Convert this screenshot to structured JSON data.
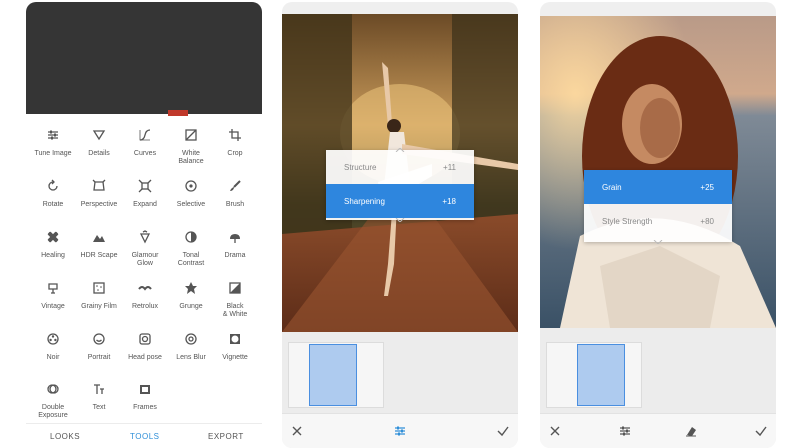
{
  "phone1": {
    "tools": [
      {
        "label": "Tune Image",
        "icon": "tune-icon"
      },
      {
        "label": "Details",
        "icon": "details-icon"
      },
      {
        "label": "Curves",
        "icon": "curves-icon"
      },
      {
        "label": "White\nBalance",
        "icon": "white-balance-icon"
      },
      {
        "label": "Crop",
        "icon": "crop-icon"
      },
      {
        "label": "Rotate",
        "icon": "rotate-icon"
      },
      {
        "label": "Perspective",
        "icon": "perspective-icon"
      },
      {
        "label": "Expand",
        "icon": "expand-icon"
      },
      {
        "label": "Selective",
        "icon": "selective-icon"
      },
      {
        "label": "Brush",
        "icon": "brush-icon"
      },
      {
        "label": "Healing",
        "icon": "healing-icon"
      },
      {
        "label": "HDR Scape",
        "icon": "hdr-icon"
      },
      {
        "label": "Glamour\nGlow",
        "icon": "glamour-glow-icon"
      },
      {
        "label": "Tonal\nContrast",
        "icon": "tonal-contrast-icon"
      },
      {
        "label": "Drama",
        "icon": "drama-icon"
      },
      {
        "label": "Vintage",
        "icon": "vintage-icon"
      },
      {
        "label": "Grainy Film",
        "icon": "grainy-film-icon"
      },
      {
        "label": "Retrolux",
        "icon": "retrolux-icon"
      },
      {
        "label": "Grunge",
        "icon": "grunge-icon"
      },
      {
        "label": "Black\n& White",
        "icon": "black-white-icon"
      },
      {
        "label": "Noir",
        "icon": "noir-icon"
      },
      {
        "label": "Portrait",
        "icon": "portrait-icon"
      },
      {
        "label": "Head pose",
        "icon": "head-pose-icon"
      },
      {
        "label": "Lens Blur",
        "icon": "lens-blur-icon"
      },
      {
        "label": "Vignette",
        "icon": "vignette-icon"
      },
      {
        "label": "Double\nExposure",
        "icon": "double-exposure-icon"
      },
      {
        "label": "Text",
        "icon": "text-icon"
      },
      {
        "label": "Frames",
        "icon": "frames-icon"
      }
    ],
    "tabs": {
      "looks": "LOOKS",
      "tools": "TOOLS",
      "export": "EXPORT"
    },
    "active_tab": "tools",
    "accent": "#2f8fd8"
  },
  "phone2": {
    "menu": [
      {
        "name": "Structure",
        "value": "+11",
        "selected": false
      },
      {
        "name": "Sharpening",
        "value": "+18",
        "selected": true
      }
    ],
    "actions": {
      "cancel": "close-icon",
      "adjust": "sliders-icon",
      "apply": "check-icon"
    }
  },
  "phone3": {
    "menu": [
      {
        "name": "Grain",
        "value": "+25",
        "selected": true
      },
      {
        "name": "Style Strength",
        "value": "+80",
        "selected": false
      }
    ],
    "actions": {
      "cancel": "close-icon",
      "adjust": "sliders-icon",
      "style": "eraser-icon",
      "apply": "check-icon"
    }
  },
  "colors": {
    "selection": "#2e86de",
    "thumb_fill": "#aecbef",
    "thumb_border": "#4a8fe0"
  }
}
